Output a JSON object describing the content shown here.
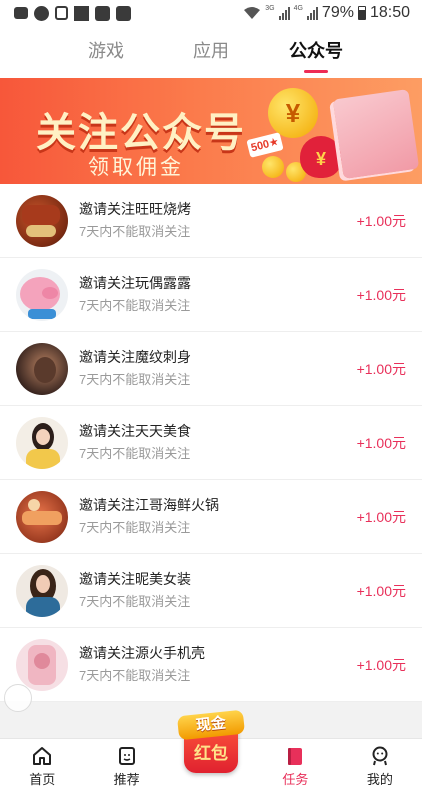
{
  "status_bar": {
    "battery": "79%",
    "time": "18:50",
    "net1": "3G",
    "net2": "4G"
  },
  "tabs": [
    {
      "label": "游戏",
      "active": false
    },
    {
      "label": "应用",
      "active": false
    },
    {
      "label": "公众号",
      "active": true
    }
  ],
  "banner": {
    "title": "关注公众号",
    "subtitle": "领取佣金",
    "coin_symbol": "¥",
    "badge": "500★",
    "bag_symbol": "¥"
  },
  "items": [
    {
      "title": "邀请关注旺旺烧烤",
      "subtitle": "7天内不能取消关注",
      "reward": "+1.00元",
      "avatar": "bbq-avatar"
    },
    {
      "title": "邀请关注玩偶露露",
      "subtitle": "7天内不能取消关注",
      "reward": "+1.00元",
      "avatar": "pig-toy-avatar"
    },
    {
      "title": "邀请关注魔纹刺身",
      "subtitle": "7天内不能取消关注",
      "reward": "+1.00元",
      "avatar": "tattoo-avatar"
    },
    {
      "title": "邀请关注天天美食",
      "subtitle": "7天内不能取消关注",
      "reward": "+1.00元",
      "avatar": "woman-avatar"
    },
    {
      "title": "邀请关注江哥海鲜火锅",
      "subtitle": "7天内不能取消关注",
      "reward": "+1.00元",
      "avatar": "seafood-avatar"
    },
    {
      "title": "邀请关注昵美女装",
      "subtitle": "7天内不能取消关注",
      "reward": "+1.00元",
      "avatar": "fashion-avatar"
    },
    {
      "title": "邀请关注源火手机壳",
      "subtitle": "7天内不能取消关注",
      "reward": "+1.00元",
      "avatar": "phonecase-avatar"
    }
  ],
  "bottom_nav": {
    "home": "首页",
    "recommend": "推荐",
    "redpack_top": "现金",
    "redpack_bottom": "红包",
    "tasks": "任务",
    "mine": "我的"
  },
  "colors": {
    "accent": "#e8305a",
    "banner_start": "#f7573a",
    "banner_end": "#fd9d63"
  }
}
